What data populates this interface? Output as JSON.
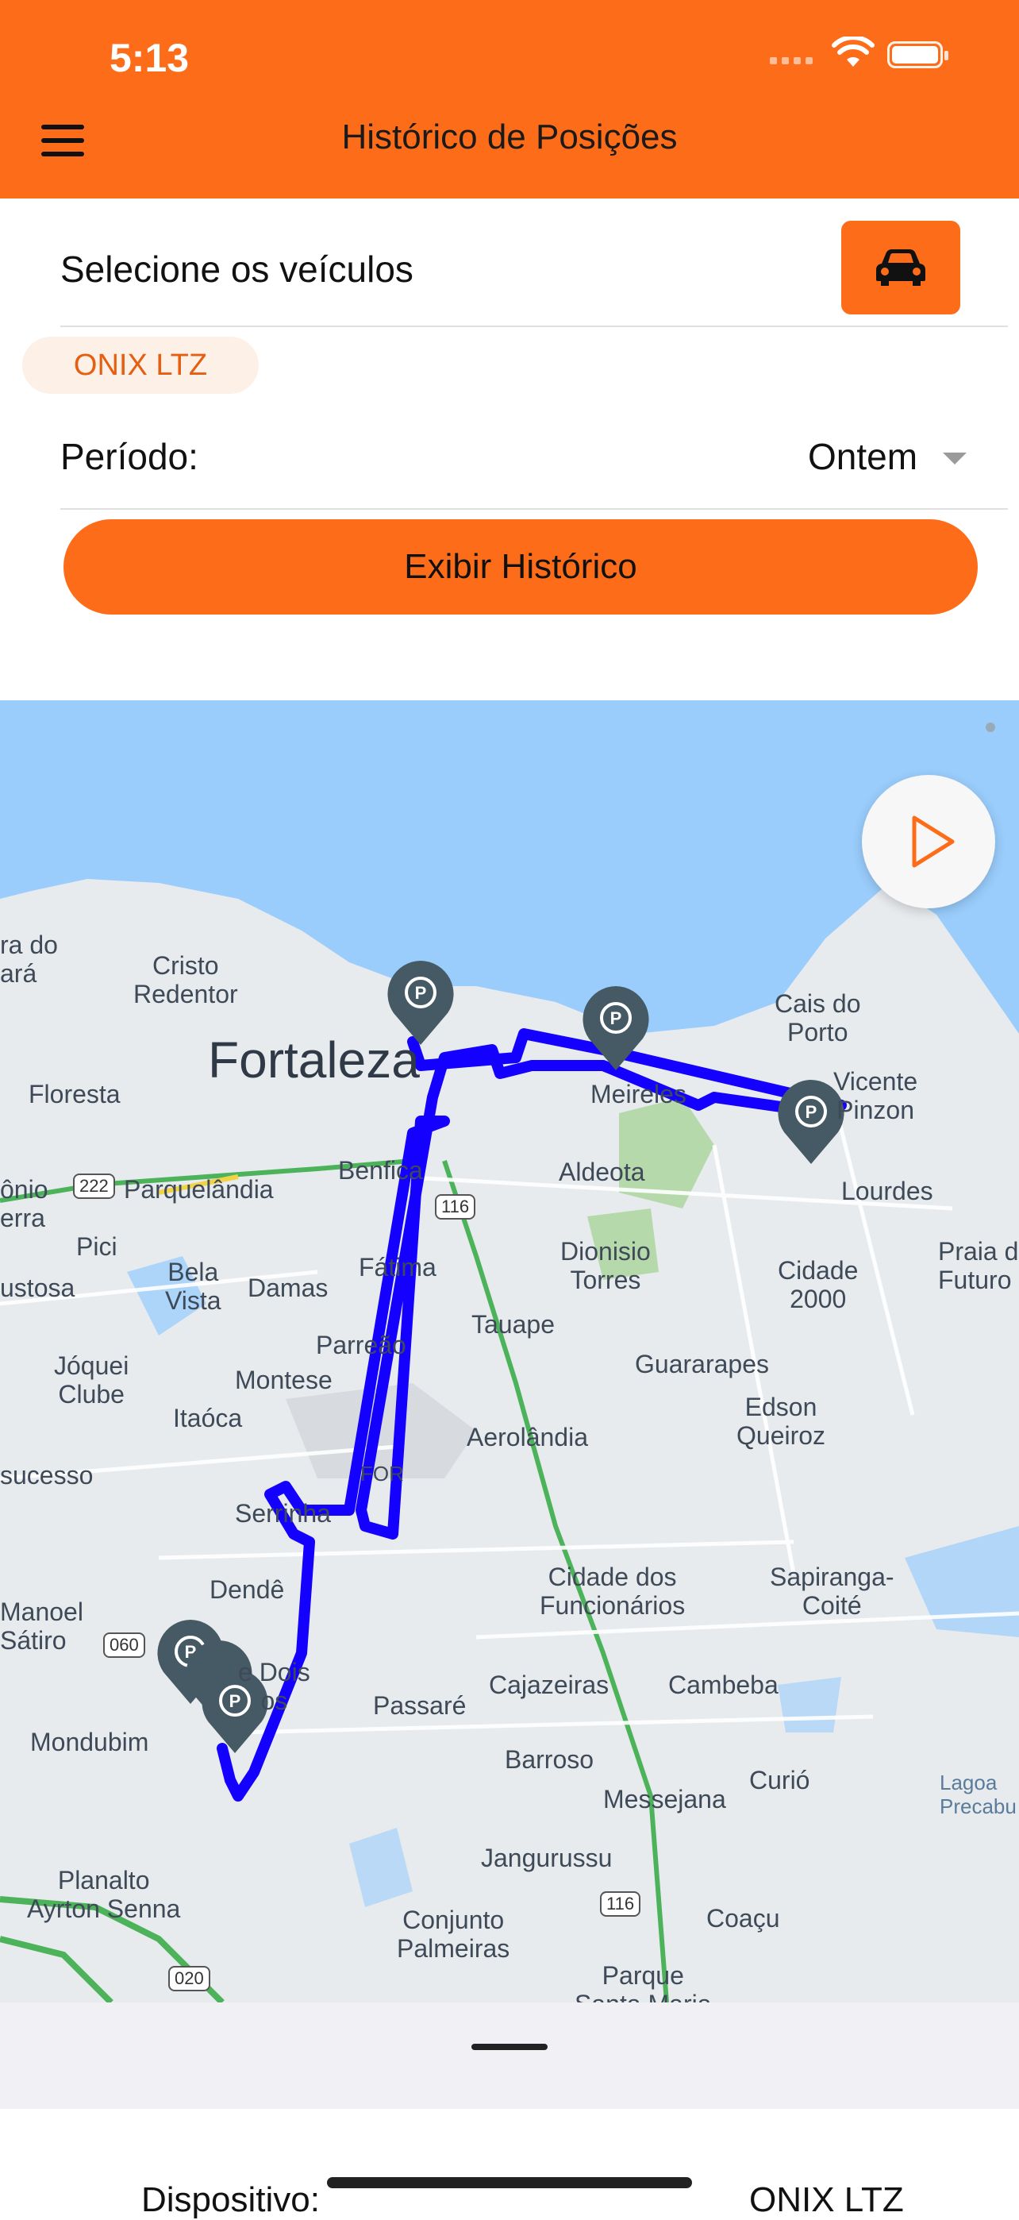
{
  "status_bar": {
    "time": "5:13"
  },
  "nav": {
    "title": "Histórico de Posições",
    "menu_icon": "hamburger-icon"
  },
  "form": {
    "vehicle_select_label": "Selecione os veículos",
    "vehicle_button_icon": "car-icon",
    "selected_vehicle": "ONIX LTZ",
    "period_label": "Período:",
    "period_value": "Ontem",
    "submit_label": "Exibir Histórico"
  },
  "map": {
    "play_icon": "play-icon",
    "route_color": "#1400ff",
    "marker_color": "#455a64",
    "labels": {
      "fortaleza": "Fortaleza",
      "cristo_redentor": "Cristo\nRedentor",
      "floresta": "Floresta",
      "cais_do_porto": "Cais do\nPorto",
      "vicente_pinzon": "Vicente\nPinzon",
      "meireles": "Meireles",
      "aldeota": "Aldeota",
      "lourdes": "Lourdes",
      "cidade_2000": "Cidade\n2000",
      "praia_do_futuro": "Praia d\nFuturo",
      "benfica": "Benfica",
      "parquelandia": "Parquelândia",
      "pici": "Pici",
      "bela_vista": "Bela\nVista",
      "damas": "Damas",
      "fatima": "Fátima",
      "dionisio_torres": "Dionisio\nTorres",
      "tauape": "Tauape",
      "guararapes": "Guararapes",
      "parreao": "Parreão",
      "joquei_clube": "Jóquei\nClube",
      "montese": "Montese",
      "itaoca": "Itaóca",
      "edson_queiroz": "Edson\nQueiroz",
      "aerolandia": "Aerolândia",
      "sucesso": "sucesso",
      "serrinha": "Serrinha",
      "for": "FOR",
      "dende": "Dendê",
      "cidade_dos_funcionarios": "Cidade dos\nFuncionários",
      "sapiranga_coite": "Sapiranga-\nCoité",
      "manoel_satiro": "Manoel\nSátiro",
      "dois_irmaos": "e Dois\nos",
      "cajazeiras": "Cajazeiras",
      "cambeba": "Cambeba",
      "passare": "Passaré",
      "mondubim": "Mondubim",
      "barroso": "Barroso",
      "curio": "Curió",
      "messejana": "Messejana",
      "lagoa_precabura": "Lagoa\nPrecabu",
      "jangurussu": "Jangurussu",
      "planalto_ayrton_senna": "Planalto\nAyrton Senna",
      "conjunto_palmeiras": "Conjunto\nPalmeiras",
      "coacu": "Coaçu",
      "parque_santa_maria": "Parque\nSanta Maria",
      "ara_do_ara": "ra do\nará",
      "onio_erra": "ônio\nerra",
      "lustosa": "ustosa",
      "shield_222": "222",
      "shield_116a": "116",
      "shield_116b": "116",
      "shield_060": "060",
      "shield_020": "020"
    }
  },
  "sheet": {
    "device_label": "Dispositivo:",
    "device_value": "ONIX LTZ"
  }
}
